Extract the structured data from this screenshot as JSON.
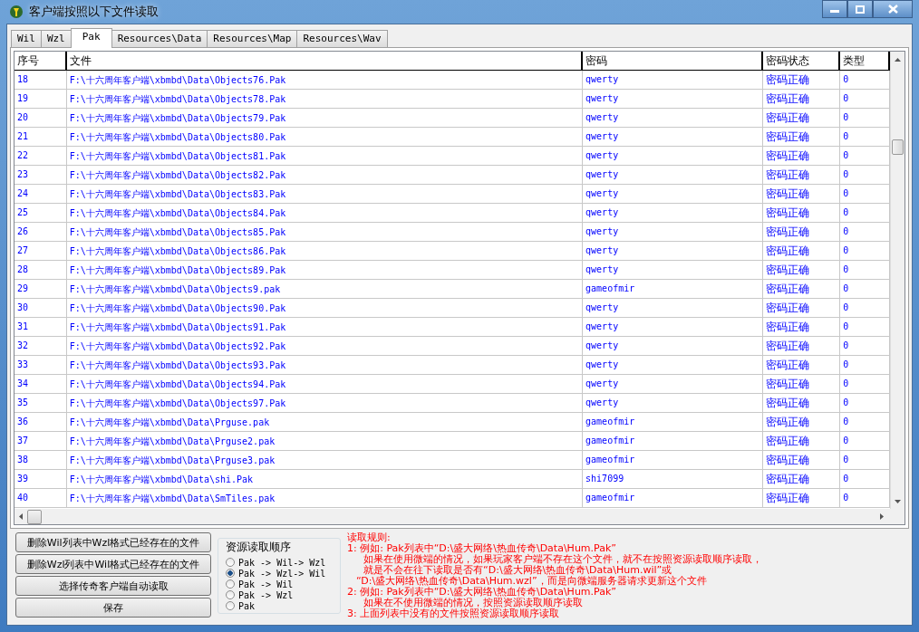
{
  "window": {
    "title": "客户端按照以下文件读取"
  },
  "tabs": [
    {
      "label": "Wil",
      "selected": false
    },
    {
      "label": "Wzl",
      "selected": false
    },
    {
      "label": "Pak",
      "selected": true
    },
    {
      "label": "Resources\\Data",
      "selected": false
    },
    {
      "label": "Resources\\Map",
      "selected": false
    },
    {
      "label": "Resources\\Wav",
      "selected": false
    }
  ],
  "table": {
    "columns": [
      "序号",
      "文件",
      "密码",
      "密码状态",
      "类型"
    ],
    "rows": [
      [
        "18",
        "F:\\十六周年客户端\\xbmbd\\Data\\Objects76.Pak",
        "qwerty",
        "密码正确",
        "0"
      ],
      [
        "19",
        "F:\\十六周年客户端\\xbmbd\\Data\\Objects78.Pak",
        "qwerty",
        "密码正确",
        "0"
      ],
      [
        "20",
        "F:\\十六周年客户端\\xbmbd\\Data\\Objects79.Pak",
        "qwerty",
        "密码正确",
        "0"
      ],
      [
        "21",
        "F:\\十六周年客户端\\xbmbd\\Data\\Objects80.Pak",
        "qwerty",
        "密码正确",
        "0"
      ],
      [
        "22",
        "F:\\十六周年客户端\\xbmbd\\Data\\Objects81.Pak",
        "qwerty",
        "密码正确",
        "0"
      ],
      [
        "23",
        "F:\\十六周年客户端\\xbmbd\\Data\\Objects82.Pak",
        "qwerty",
        "密码正确",
        "0"
      ],
      [
        "24",
        "F:\\十六周年客户端\\xbmbd\\Data\\Objects83.Pak",
        "qwerty",
        "密码正确",
        "0"
      ],
      [
        "25",
        "F:\\十六周年客户端\\xbmbd\\Data\\Objects84.Pak",
        "qwerty",
        "密码正确",
        "0"
      ],
      [
        "26",
        "F:\\十六周年客户端\\xbmbd\\Data\\Objects85.Pak",
        "qwerty",
        "密码正确",
        "0"
      ],
      [
        "27",
        "F:\\十六周年客户端\\xbmbd\\Data\\Objects86.Pak",
        "qwerty",
        "密码正确",
        "0"
      ],
      [
        "28",
        "F:\\十六周年客户端\\xbmbd\\Data\\Objects89.Pak",
        "qwerty",
        "密码正确",
        "0"
      ],
      [
        "29",
        "F:\\十六周年客户端\\xbmbd\\Data\\Objects9.pak",
        "gameofmir",
        "密码正确",
        "0"
      ],
      [
        "30",
        "F:\\十六周年客户端\\xbmbd\\Data\\Objects90.Pak",
        "qwerty",
        "密码正确",
        "0"
      ],
      [
        "31",
        "F:\\十六周年客户端\\xbmbd\\Data\\Objects91.Pak",
        "qwerty",
        "密码正确",
        "0"
      ],
      [
        "32",
        "F:\\十六周年客户端\\xbmbd\\Data\\Objects92.Pak",
        "qwerty",
        "密码正确",
        "0"
      ],
      [
        "33",
        "F:\\十六周年客户端\\xbmbd\\Data\\Objects93.Pak",
        "qwerty",
        "密码正确",
        "0"
      ],
      [
        "34",
        "F:\\十六周年客户端\\xbmbd\\Data\\Objects94.Pak",
        "qwerty",
        "密码正确",
        "0"
      ],
      [
        "35",
        "F:\\十六周年客户端\\xbmbd\\Data\\Objects97.Pak",
        "qwerty",
        "密码正确",
        "0"
      ],
      [
        "36",
        "F:\\十六周年客户端\\xbmbd\\Data\\Prguse.pak",
        "gameofmir",
        "密码正确",
        "0"
      ],
      [
        "37",
        "F:\\十六周年客户端\\xbmbd\\Data\\Prguse2.pak",
        "gameofmir",
        "密码正确",
        "0"
      ],
      [
        "38",
        "F:\\十六周年客户端\\xbmbd\\Data\\Prguse3.pak",
        "gameofmir",
        "密码正确",
        "0"
      ],
      [
        "39",
        "F:\\十六周年客户端\\xbmbd\\Data\\shi.Pak",
        "shi7099",
        "密码正确",
        "0"
      ],
      [
        "40",
        "F:\\十六周年客户端\\xbmbd\\Data\\SmTiles.pak",
        "gameofmir",
        "密码正确",
        "0"
      ]
    ]
  },
  "buttons": [
    "删除Wil列表中Wzl格式已经存在的文件",
    "删除Wzl列表中Wil格式已经存在的文件",
    "选择传奇客户端自动读取",
    "保存"
  ],
  "read_order": {
    "title": "资源读取顺序",
    "options": [
      {
        "label": "Pak -> Wil-> Wzl",
        "selected": false
      },
      {
        "label": "Pak -> Wzl-> Wil",
        "selected": true
      },
      {
        "label": "Pak -> Wil",
        "selected": false
      },
      {
        "label": "Pak -> Wzl",
        "selected": false
      },
      {
        "label": "Pak",
        "selected": false
      }
    ]
  },
  "rules": [
    {
      "kind": "heading",
      "text": "读取规则:"
    },
    {
      "kind": "item",
      "text": "1: 例如: Pak列表中“D:\\盛大网络\\热血传奇\\Data\\Hum.Pak”"
    },
    {
      "kind": "continuation",
      "text": "如果在使用微端的情况，如果玩家客户端不存在这个文件，就不在按照资源读取顺序读取，"
    },
    {
      "kind": "continuation",
      "text": "就是不会在往下读取是否有“D:\\盛大网络\\热血传奇\\Data\\Hum.wil”或"
    },
    {
      "kind": "quote",
      "text": "“D:\\盛大网络\\热血传奇\\Data\\Hum.wzl”，而是向微端服务器请求更新这个文件"
    },
    {
      "kind": "item",
      "text": "2: 例如: Pak列表中“D:\\盛大网络\\热血传奇\\Data\\Hum.Pak”"
    },
    {
      "kind": "continuation",
      "text": "如果在不使用微端的情况，按照资源读取顺序读取"
    },
    {
      "kind": "item",
      "text": "3: 上面列表中没有的文件按照资源读取顺序读取"
    }
  ]
}
